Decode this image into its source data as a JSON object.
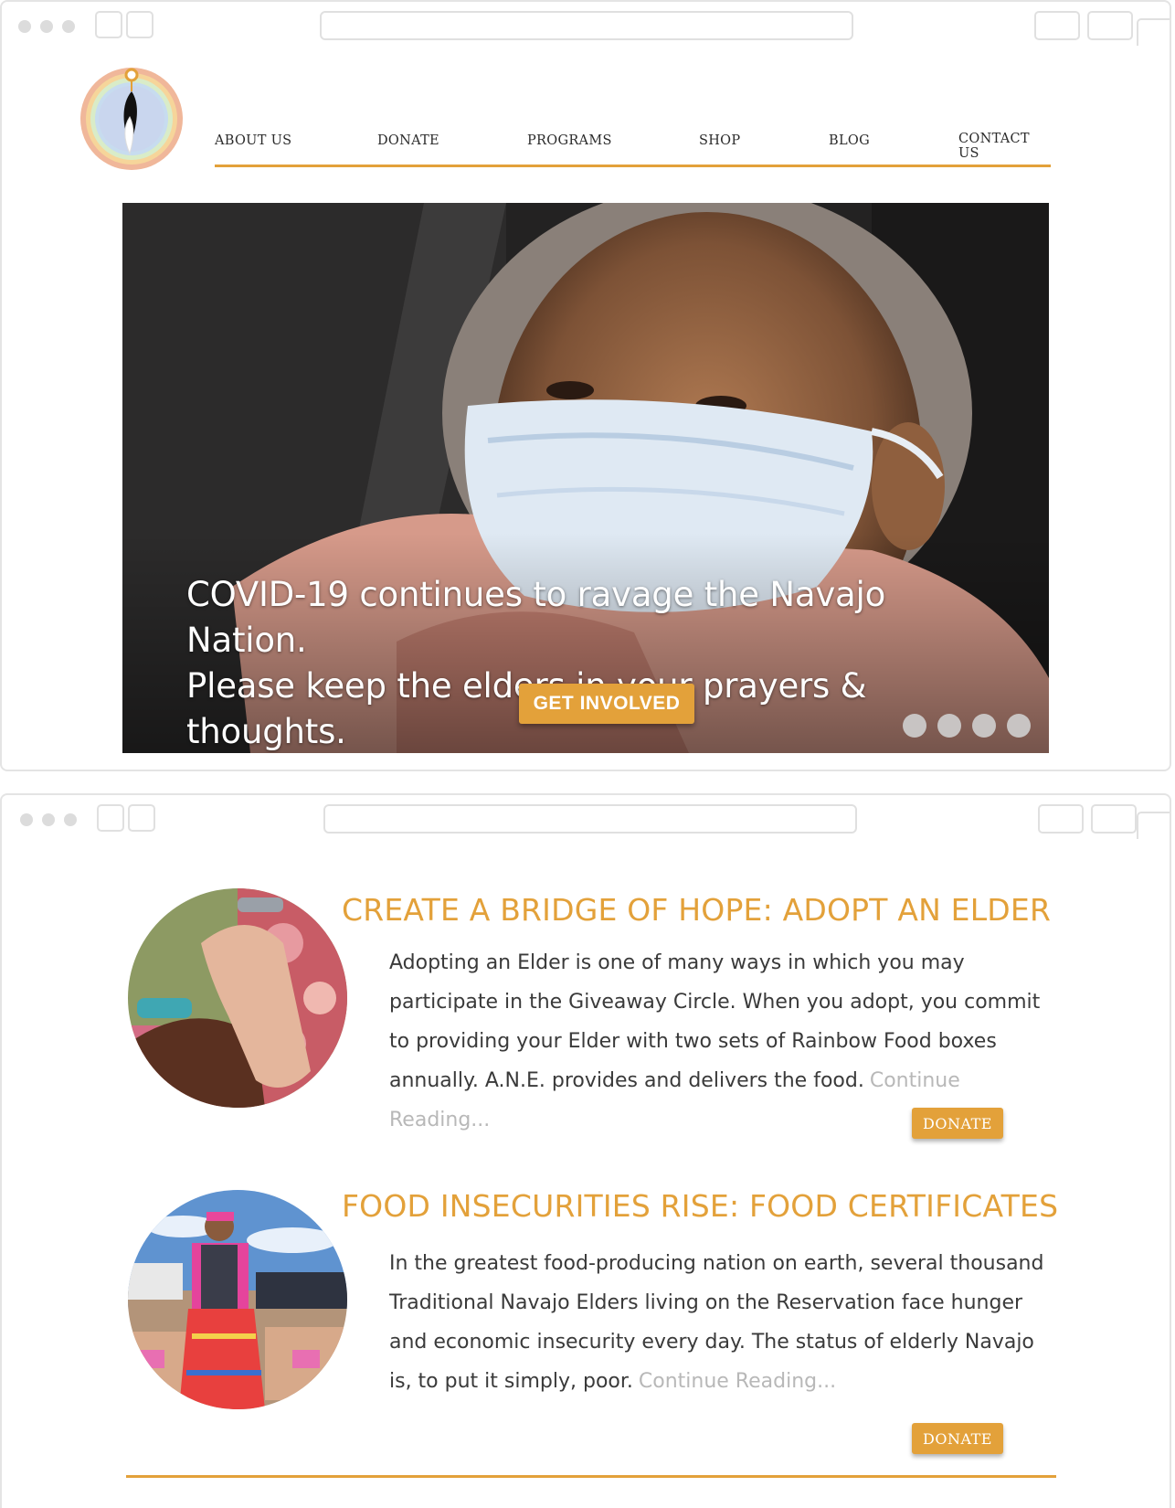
{
  "nav": {
    "items": [
      "ABOUT US",
      "DONATE",
      "PROGRAMS",
      "SHOP",
      "BLOG",
      "CONTACT US"
    ]
  },
  "hero": {
    "line1": "COVID-19 continues to ravage the Navajo Nation.",
    "line2": "Please keep the elders in your prayers & thoughts.",
    "button": "GET INVOLVED",
    "slide_count": 4,
    "active_slide": 1
  },
  "articles": [
    {
      "title": "CREATE A BRIDGE OF HOPE: ADOPT AN ELDER",
      "body": "Adopting an Elder is one of many ways in which you may participate in the Giveaway Circle. When you adopt, you commit to providing your Elder with two sets of Rainbow Food boxes annually. A.N.E. provides and  delivers the food.",
      "more": "Continue Reading...",
      "button": "DONATE"
    },
    {
      "title": "FOOD INSECURITIES RISE: FOOD CERTIFICATES",
      "body": "In the greatest food-producing nation on earth, several thousand Traditional Navajo Elders living on the Reservation face hunger and economic insecurity every day. The status of elderly Navajo is, to put it simply, poor.",
      "more": "Continue Reading...",
      "button": "DONATE"
    }
  ],
  "colors": {
    "accent": "#e3a13a",
    "text": "#3a3a3a",
    "muted": "#b8b8b8"
  }
}
